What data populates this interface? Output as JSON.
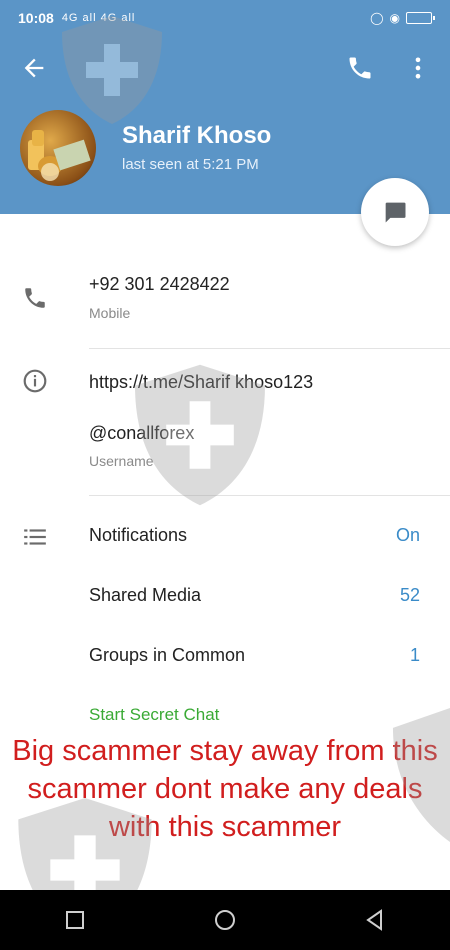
{
  "status_bar": {
    "time": "10:08",
    "signal": "4G all 4G all"
  },
  "contact": {
    "name": "Sharif Khoso",
    "last_seen": "last seen at 5:21 PM"
  },
  "info": {
    "phone": {
      "value": "+92 301 2428422",
      "label": "Mobile"
    },
    "link": "https://t.me/Sharif khoso123",
    "username": {
      "value": "@conallforex",
      "label": "Username"
    }
  },
  "settings": {
    "notifications": {
      "label": "Notifications",
      "value": "On"
    },
    "shared_media": {
      "label": "Shared Media",
      "value": "52"
    },
    "groups_common": {
      "label": "Groups in Common",
      "value": "1"
    },
    "secret_chat": "Start Secret Chat"
  },
  "overlay_text": "Big scammer stay away from this scammer dont make any deals with this scammer",
  "colors": {
    "header": "#5b95c7",
    "accent": "#3a8bc8",
    "secret": "#3aaa35",
    "warning": "#d11e1e"
  }
}
